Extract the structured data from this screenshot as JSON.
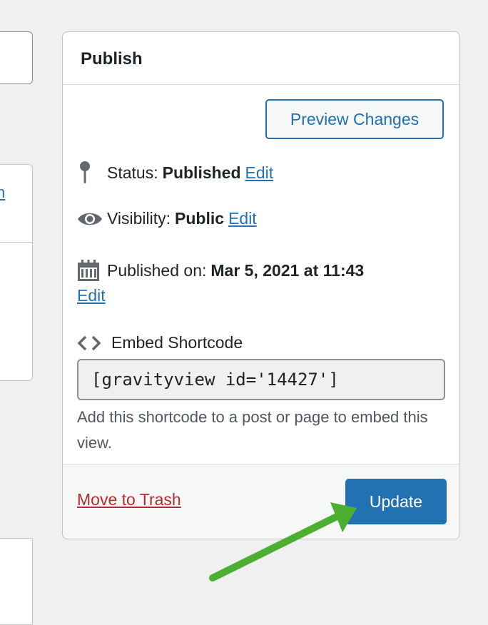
{
  "publish_box": {
    "title": "Publish",
    "preview_button": "Preview Changes",
    "status": {
      "label": "Status:",
      "value": "Published",
      "edit_link": "Edit"
    },
    "visibility": {
      "label": "Visibility:",
      "value": "Public",
      "edit_link": "Edit"
    },
    "published_on": {
      "label": "Published on:",
      "value": "Mar 5, 2021 at 11:43",
      "edit_link": "Edit"
    },
    "embed": {
      "label": "Embed Shortcode",
      "shortcode": "[gravityview id='14427']",
      "help": "Add this shortcode to a post or page to embed this view."
    },
    "footer": {
      "trash_link": "Move to Trash",
      "update_button": "Update"
    }
  },
  "left_fragment_text": "n",
  "icons": [
    "pin-icon",
    "eye-icon",
    "calendar-icon",
    "code-icon",
    "annotation-arrow"
  ],
  "colors": {
    "accent": "#2271b1",
    "danger": "#b32d2e",
    "annotation": "#4caf32"
  }
}
